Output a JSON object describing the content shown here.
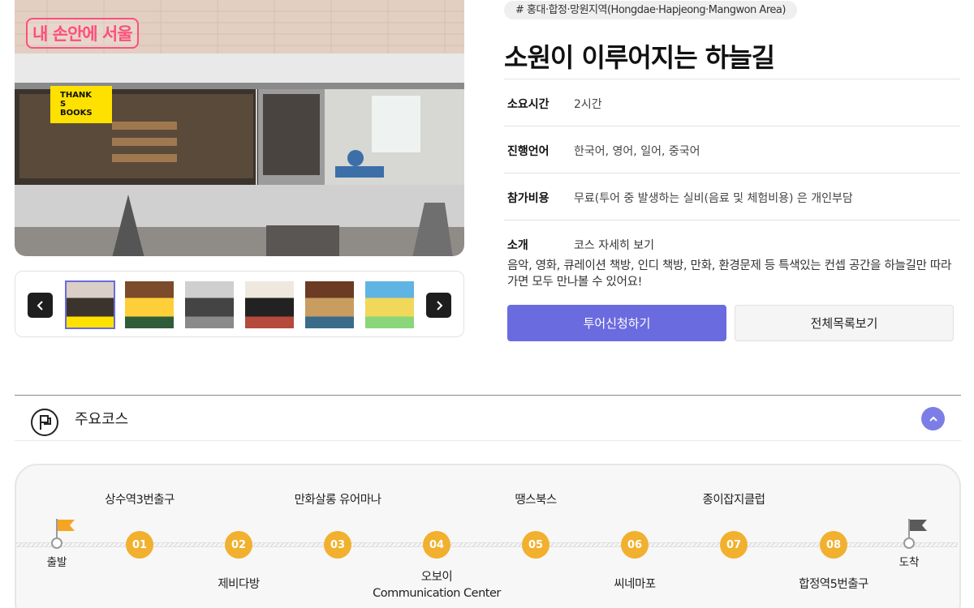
{
  "photo": {
    "watermark": "내 손안에 서울",
    "sign_text": "THANK\nS\nBOOKS"
  },
  "gallery": {
    "thumbnails": [
      {
        "name": "thanks-books-storefront",
        "colors": [
          "#d9cfc6",
          "#3b342c",
          "#ffe100"
        ]
      },
      {
        "name": "shop-interior",
        "colors": [
          "#7b4b2c",
          "#ffcf3a",
          "#2f5d3a"
        ]
      },
      {
        "name": "street-view",
        "colors": [
          "#cfcfcf",
          "#444",
          "#8a8a8a"
        ]
      },
      {
        "name": "poster-wall",
        "colors": [
          "#efe8dd",
          "#222",
          "#b54a3c"
        ]
      },
      {
        "name": "bookshelf",
        "colors": [
          "#6b3b24",
          "#c99d5f",
          "#3b6b8a"
        ]
      },
      {
        "name": "illustration",
        "colors": [
          "#5fb4e3",
          "#f1d85a",
          "#8ad67a"
        ]
      }
    ]
  },
  "info": {
    "tag": "# 홍대·합정·망원지역(Hongdae·Hapjeong·Mangwon Area)",
    "title": "소원이 이루어지는 하늘길",
    "duration_label": "소요시간",
    "duration_value": "2시간",
    "language_label": "진행언어",
    "language_value": "한국어, 영어, 일어, 중국어",
    "cost_label": "참가비용",
    "cost_value": "무료(투어 중 발생하는 실비(음료 및 체험비용) 은 개인부담",
    "intro_label": "소개",
    "intro_link": "코스 자세히 보기",
    "intro_desc": "음악, 영화, 큐레이션 책방, 인디 책방, 만화, 환경문제 등 특색있는 컨셉 공간을 하늘길만 따라가면 모두 만나볼 수 있어요!",
    "apply_button": "투어신청하기",
    "list_button": "전체목록보기"
  },
  "course": {
    "section_title": "주요코스",
    "start_label": "출발",
    "end_label": "도착",
    "stops": [
      {
        "num": "01",
        "label": "상수역3번출구"
      },
      {
        "num": "02",
        "label": "제비다방"
      },
      {
        "num": "03",
        "label": "만화살롱 유어마나"
      },
      {
        "num": "04",
        "label": "오보이\nCommunication Center"
      },
      {
        "num": "05",
        "label": "땡스북스"
      },
      {
        "num": "06",
        "label": "씨네마포"
      },
      {
        "num": "07",
        "label": "종이잡지클럽"
      },
      {
        "num": "08",
        "label": "합정역5번출구"
      }
    ],
    "colors": {
      "stop": "#f1b02e",
      "start_flag": "#f4a623",
      "end_flag": "#5a5a5a",
      "accent": "#6b6be0"
    }
  }
}
